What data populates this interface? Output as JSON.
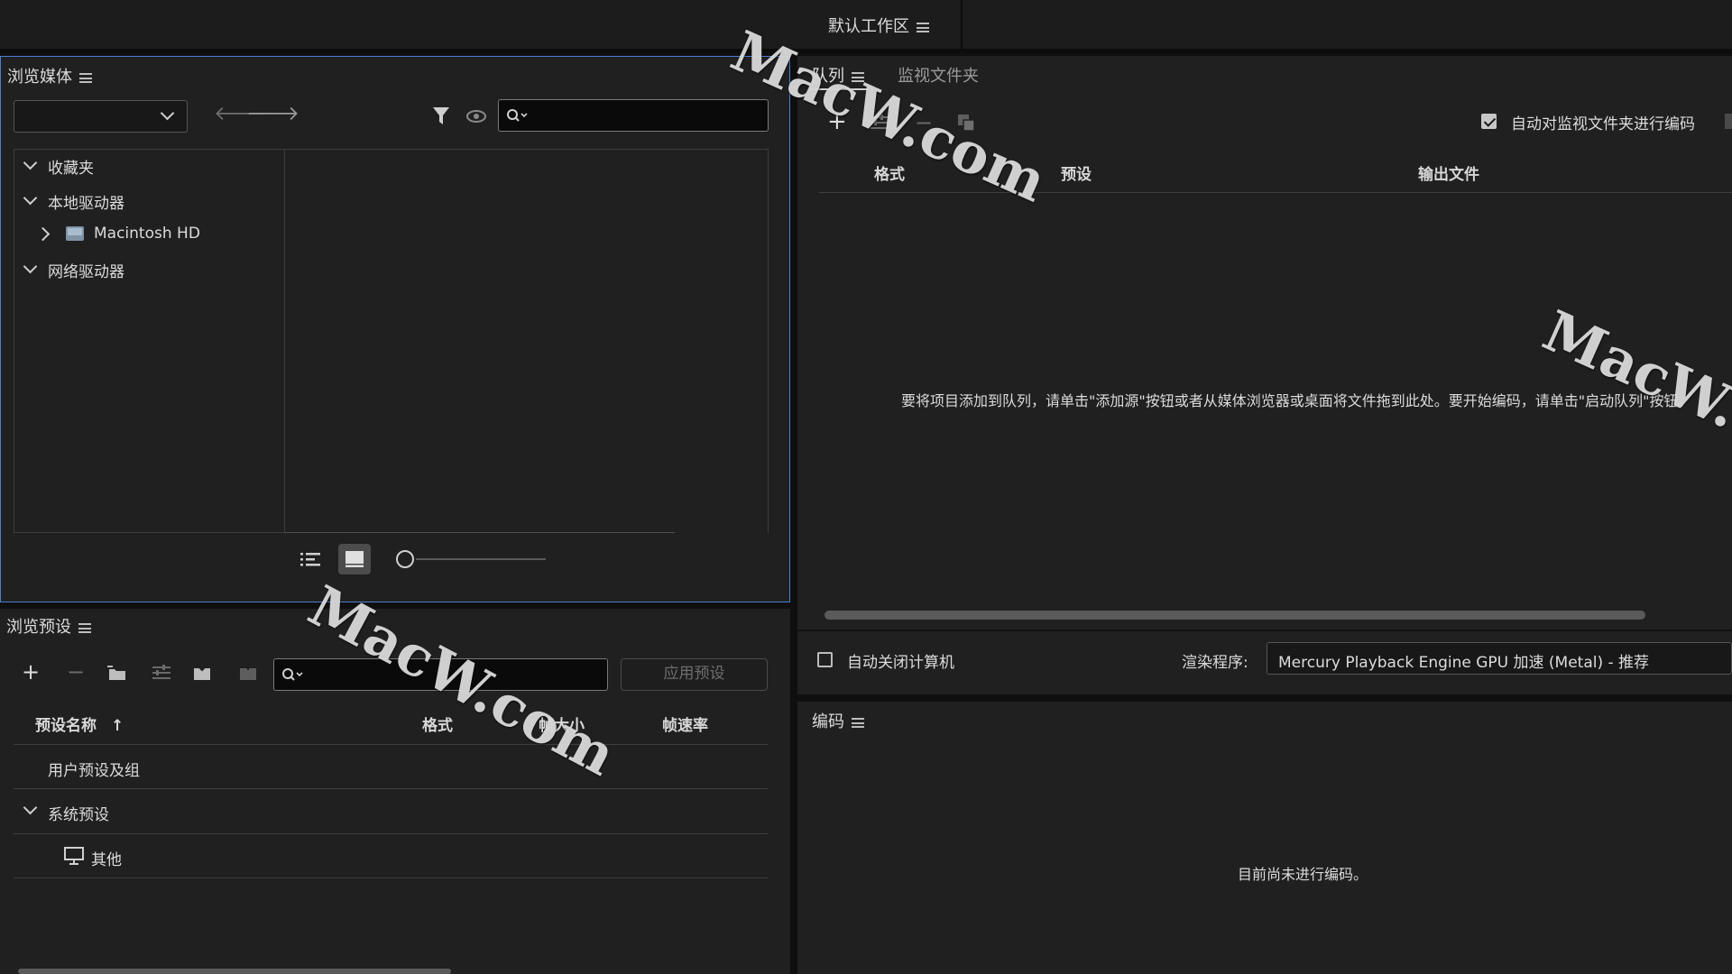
{
  "workspace": {
    "label": "默认工作区"
  },
  "media_browser": {
    "title": "浏览媒体",
    "tree": {
      "favorites": "收藏夹",
      "local_drives": "本地驱动器",
      "macintosh_hd": "Macintosh HD",
      "network_drives": "网络驱动器"
    }
  },
  "preset_browser": {
    "title": "浏览预设",
    "apply_label": "应用预设",
    "columns": {
      "name": "预设名称",
      "format": "格式",
      "frame_size": "帧大小",
      "frame_rate": "帧速率"
    },
    "rows": {
      "user": "用户预设及组",
      "system": "系统预设",
      "other": "其他"
    }
  },
  "queue": {
    "tab_queue": "队列",
    "tab_watch": "监视文件夹",
    "auto_encode_label": "自动对监视文件夹进行编码",
    "columns": {
      "format": "格式",
      "preset": "预设",
      "output": "输出文件"
    },
    "empty_message": "要将项目添加到队列，请单击\"添加源\"按钮或者从媒体浏览器或桌面将文件拖到此处。要开始编码，请单击\"启动队列\"按钮。",
    "auto_shutdown_label": "自动关闭计算机",
    "renderer_label": "渲染程序:",
    "renderer_value": "Mercury Playback Engine GPU 加速 (Metal) - 推荐"
  },
  "encoding": {
    "title": "编码",
    "empty_message": "目前尚未进行编码。"
  },
  "watermark": {
    "text": "MacW.com"
  },
  "colors": {
    "panel": "#202020",
    "background": "#0f0f0f",
    "focus_border": "#4a7fd6"
  }
}
